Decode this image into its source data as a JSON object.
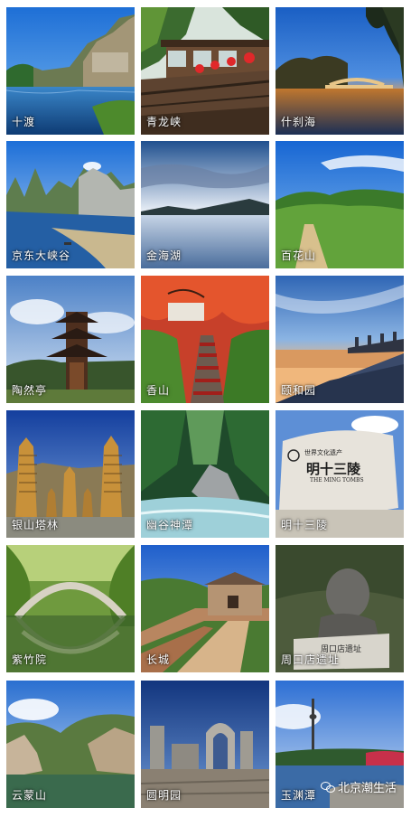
{
  "tiles": [
    {
      "id": "shidu",
      "caption": "十渡"
    },
    {
      "id": "qinglongxia",
      "caption": "青龙峡"
    },
    {
      "id": "shichahai",
      "caption": "什刹海"
    },
    {
      "id": "jingdong-daxiagu",
      "caption": "京东大峡谷"
    },
    {
      "id": "jinhaihu",
      "caption": "金海湖"
    },
    {
      "id": "baihuashan",
      "caption": "百花山"
    },
    {
      "id": "taoranting",
      "caption": "陶然亭"
    },
    {
      "id": "xiangshan",
      "caption": "香山"
    },
    {
      "id": "yiheyuan",
      "caption": "颐和园"
    },
    {
      "id": "yinshan-talin",
      "caption": "银山塔林"
    },
    {
      "id": "yougu-shentan",
      "caption": "幽谷神潭"
    },
    {
      "id": "ming-tombs",
      "caption": "明十三陵"
    },
    {
      "id": "zizhuyuan",
      "caption": "紫竹院"
    },
    {
      "id": "changcheng",
      "caption": "长城"
    },
    {
      "id": "zhoukoudian",
      "caption": "周口店遗址"
    },
    {
      "id": "yunmengshan",
      "caption": "云蒙山"
    },
    {
      "id": "yuanmingyuan",
      "caption": "圆明园"
    },
    {
      "id": "yuyuantan",
      "caption": "玉渊潭"
    }
  ],
  "stone_tablet": {
    "heritage": "世界文化遗产",
    "title": "明十三陵",
    "english": "THE MING TOMBS"
  },
  "stele": {
    "text": "周口店遗址"
  },
  "watermark": {
    "text": "北京潮生活",
    "icon": "wechat-icon"
  }
}
